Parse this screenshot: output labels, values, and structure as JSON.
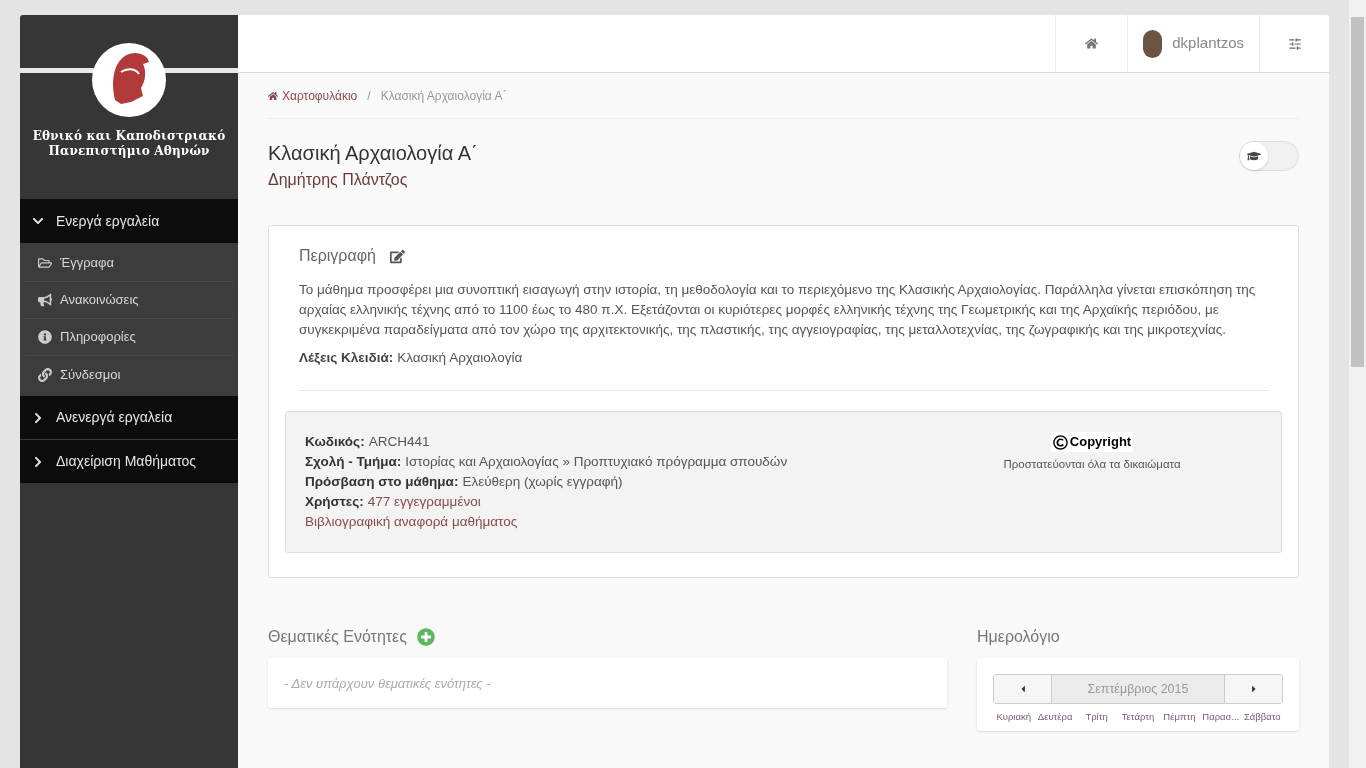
{
  "sidebar": {
    "institution": [
      "Εθνικό και Καποδιστριακό",
      "Πανεπιστήμιο Αθηνών"
    ],
    "groups": [
      {
        "label": "Ενεργά εργαλεία",
        "expanded": true,
        "items": [
          {
            "label": "Έγγραφα",
            "kind": "folder"
          },
          {
            "label": "Ανακοινώσεις",
            "kind": "bullhorn"
          },
          {
            "label": "Πληροφορίες",
            "kind": "info"
          },
          {
            "label": "Σύνδεσμοι",
            "kind": "link"
          }
        ]
      },
      {
        "label": "Ανενεργά εργαλεία",
        "expanded": false
      },
      {
        "label": "Διαχείριση Μαθήματος",
        "expanded": false
      }
    ]
  },
  "header": {
    "username": "dkplantzos"
  },
  "breadcrumb": {
    "separator": "/",
    "items": [
      {
        "label": "Χαρτοφυλάκιο",
        "selected": false
      },
      {
        "label": "Κλασική Αρχαιολογία Α΄",
        "selected": true
      }
    ]
  },
  "course": {
    "title": "Κλασική Αρχαιολογία Α΄",
    "instructor": "Δημήτρης Πλάντζος",
    "student_view": {
      "on": false
    }
  },
  "description": {
    "heading": "Περιγραφή",
    "text": "Το μάθημα προσφέρει μια συνοπτική εισαγωγή στην ιστορία, τη μεθοδολογία και το περιεχόμενο της Κλασικής Αρχαιολογίας. Παράλληλα γίνεται επισκόπηση της αρχαίας ελληνικής τέχνης από το 1100 έως το 480 π.Χ. Εξετάζονται οι κυριότερες μορφές ελληνικής τέχνης της Γεωμετρικής και της Αρχαϊκής περιόδου, με συγκεκριμένα παραδείγματα από τον χώρο της αρχιτεκτονικής, της πλαστικής, της αγγειογραφίας, της μεταλλοτεχνίας, της ζωγραφικής και της μικροτεχνίας.",
    "keywords_label": "Λέξεις Κλειδιά:",
    "keywords": "Κλασική Αρχαιολογία"
  },
  "info": {
    "rows": [
      {
        "label": "Κωδικός:",
        "value": "ARCH441",
        "kind": "text"
      },
      {
        "label": "Σχολή - Τμήμα:",
        "value": "Ιστορίας και Αρχαιολογίας » Προπτυχιακό πρόγραμμα σπουδών",
        "kind": "text"
      },
      {
        "label": "Πρόσβαση στο μάθημα:",
        "value": "Ελεύθερη (χωρίς εγγραφή)",
        "kind": "text"
      },
      {
        "label": "Χρήστες:",
        "value": "477 εγγεγραμμένοι",
        "kind": "link"
      }
    ],
    "citation_link": "Βιβλιογραφική αναφορά μαθήματος",
    "license": {
      "title": "Copyright",
      "note": "Προστατεύονται όλα τα δικαιώματα"
    }
  },
  "units": {
    "heading": "Θεματικές Ενότητες",
    "empty": "- Δεν υπάρχουν θεματικές ενότητες -"
  },
  "calendar": {
    "heading": "Ημερολόγιο",
    "month": "Σεπτέμβριος 2015",
    "weekdays": [
      "Κυριακή",
      "Δευτέρα",
      "Τρίτη",
      "Τετάρτη",
      "Πέμπτη",
      "Παρασ...",
      "Σάββατο"
    ]
  }
}
